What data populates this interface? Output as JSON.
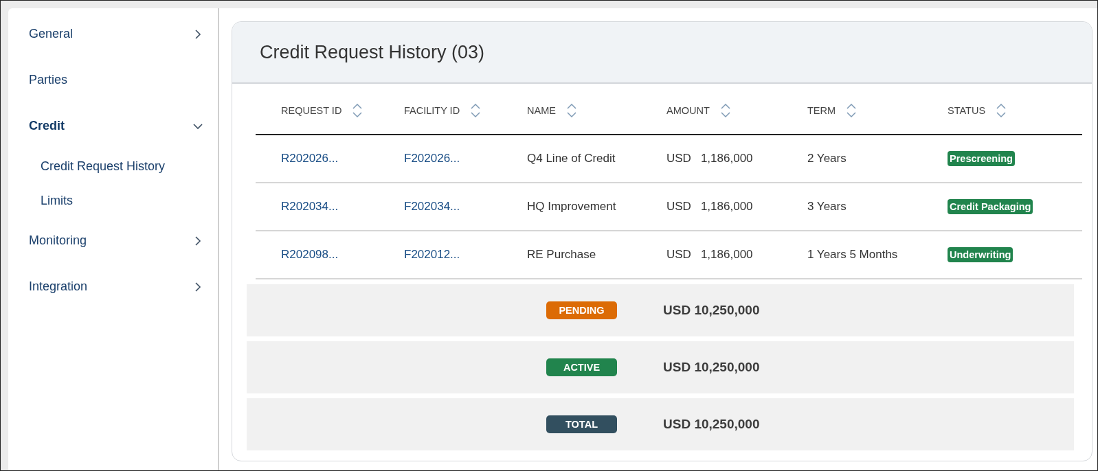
{
  "sidebar": {
    "items": [
      {
        "label": "General",
        "kind": "group",
        "expanded": false,
        "selected": false
      },
      {
        "label": "Parties",
        "kind": "link",
        "selected": false
      },
      {
        "label": "Credit",
        "kind": "group",
        "expanded": true,
        "selected": true,
        "children": [
          {
            "label": "Credit Request History"
          },
          {
            "label": "Limits"
          }
        ]
      },
      {
        "label": "Monitoring",
        "kind": "group",
        "expanded": false,
        "selected": false
      },
      {
        "label": "Integration",
        "kind": "group",
        "expanded": false,
        "selected": false
      }
    ]
  },
  "card": {
    "title": "Credit Request History (03)",
    "table": {
      "columns": [
        "REQUEST ID",
        "FACILITY ID",
        "NAME",
        "AMOUNT",
        "TERM",
        "STATUS"
      ],
      "rows": [
        {
          "request_id": "R202026...",
          "facility_id": "F202026...",
          "name": "Q4 Line of Credit",
          "currency": "USD",
          "amount": "1,186,000",
          "term": "2 Years",
          "status": "Prescreening"
        },
        {
          "request_id": "R202034...",
          "facility_id": "F202034...",
          "name": "HQ Improvement",
          "currency": "USD",
          "amount": "1,186,000",
          "term": "3 Years",
          "status": "Credit Packaging"
        },
        {
          "request_id": "R202098...",
          "facility_id": "F202012...",
          "name": "RE Purchase",
          "currency": "USD",
          "amount": "1,186,000",
          "term": "1 Years 5 Months",
          "status": "Underwriting"
        }
      ]
    },
    "summary": [
      {
        "label": "PENDING",
        "color": "#dc6b05",
        "amount": "USD 10,250,000"
      },
      {
        "label": "ACTIVE",
        "color": "#21844d",
        "amount": "USD 10,250,000"
      },
      {
        "label": "TOTAL",
        "color": "#324f5f",
        "amount": "USD 10,250,000"
      }
    ]
  }
}
